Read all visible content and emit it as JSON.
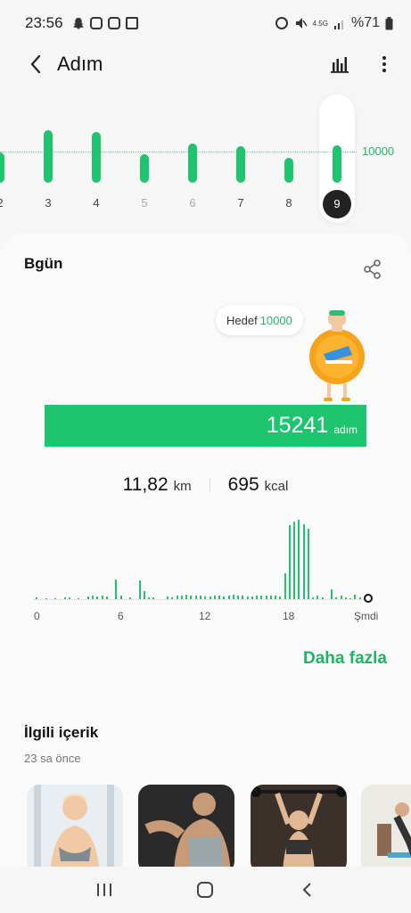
{
  "status_bar": {
    "time": "23:56",
    "network": "4.5G",
    "battery": "%71",
    "icons": [
      "snapchat-icon",
      "instagram-icon",
      "instagram-icon",
      "app-icon",
      "alarm-icon",
      "mute-icon",
      "signal-icon",
      "battery-icon"
    ]
  },
  "header": {
    "title": "Adım",
    "back_icon": "chevron-left-icon",
    "chart_icon": "bar-chart-icon",
    "menu_icon": "more-vertical-icon"
  },
  "week_chart": {
    "goal_label": "10000",
    "days": [
      {
        "label": "2",
        "value": 9000,
        "muted": false,
        "selected": false
      },
      {
        "label": "3",
        "value": 15500,
        "muted": false,
        "selected": false
      },
      {
        "label": "4",
        "value": 15000,
        "muted": false,
        "selected": false
      },
      {
        "label": "5",
        "value": 8500,
        "muted": true,
        "selected": false
      },
      {
        "label": "6",
        "value": 11500,
        "muted": true,
        "selected": false
      },
      {
        "label": "7",
        "value": 10800,
        "muted": false,
        "selected": false
      },
      {
        "label": "8",
        "value": 7500,
        "muted": false,
        "selected": false
      },
      {
        "label": "9",
        "value": 11000,
        "muted": false,
        "selected": true
      }
    ]
  },
  "card": {
    "title": "Bgün",
    "goal_text": "Hedef",
    "goal_value": "10000",
    "steps_value": "15241",
    "steps_unit": "adım",
    "distance_value": "11,82",
    "distance_unit": "km",
    "calories_value": "695",
    "calories_unit": "kcal",
    "hourly_ticks": [
      "0",
      "6",
      "12",
      "18",
      "Şmdi"
    ],
    "hourly_values": [
      0.02,
      0,
      0.01,
      0,
      0.01,
      0,
      0.02,
      0.02,
      0,
      0.01,
      0,
      0.03,
      0.05,
      0.03,
      0.04,
      0.03,
      0,
      0.24,
      0.05,
      0,
      0.02,
      0,
      0.23,
      0.1,
      0.02,
      0.02,
      0,
      0,
      0.03,
      0.02,
      0.04,
      0.05,
      0.06,
      0.05,
      0.05,
      0.04,
      0.03,
      0.03,
      0.04,
      0.04,
      0.03,
      0.05,
      0.06,
      0.04,
      0.04,
      0.03,
      0.03,
      0.04,
      0.05,
      0.04,
      0.04,
      0.04,
      0.03,
      0.32,
      0.92,
      0.97,
      0.99,
      0.93,
      0.88,
      0.02,
      0.05,
      0.02,
      0,
      0.12,
      0.02,
      0.05,
      0.02,
      0.01,
      0.06,
      0.02
    ],
    "more_label": "Daha fazla",
    "related_title": "İlgili içerik",
    "related_sub": "23 sa önce",
    "thumbnails": [
      "woman-fitness-photo",
      "man-gym-photo",
      "woman-lifting-photo",
      "woman-home-exercise-photo"
    ]
  },
  "colors": {
    "accent": "#1ec46e",
    "accent_text": "#22b468",
    "background": "#f6f6f6",
    "card": "#fafafa"
  },
  "nav_bar": {
    "icons": [
      "recent-apps-icon",
      "home-icon",
      "back-icon"
    ]
  }
}
